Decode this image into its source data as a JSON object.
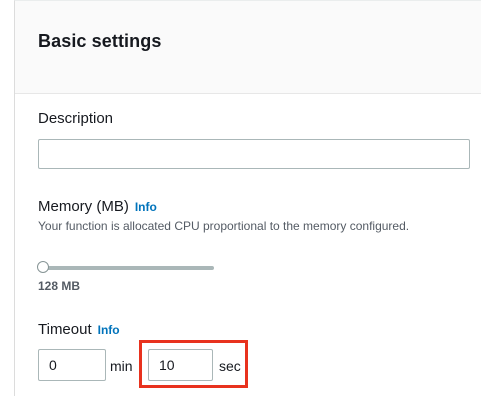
{
  "section": {
    "title": "Basic settings"
  },
  "description": {
    "label": "Description",
    "value": "",
    "placeholder": ""
  },
  "memory": {
    "label": "Memory (MB)",
    "info_link": "Info",
    "hint": "Your function is allocated CPU proportional to the memory configured.",
    "value_text": "128 MB",
    "slider_fraction": 0.0
  },
  "timeout": {
    "label": "Timeout",
    "info_link": "Info",
    "minutes_value": "0",
    "minutes_unit": "min",
    "seconds_value": "10",
    "seconds_unit": "sec"
  },
  "colors": {
    "link": "#0073bb",
    "highlight": "#e8321e",
    "header_bg": "#fafafa"
  }
}
